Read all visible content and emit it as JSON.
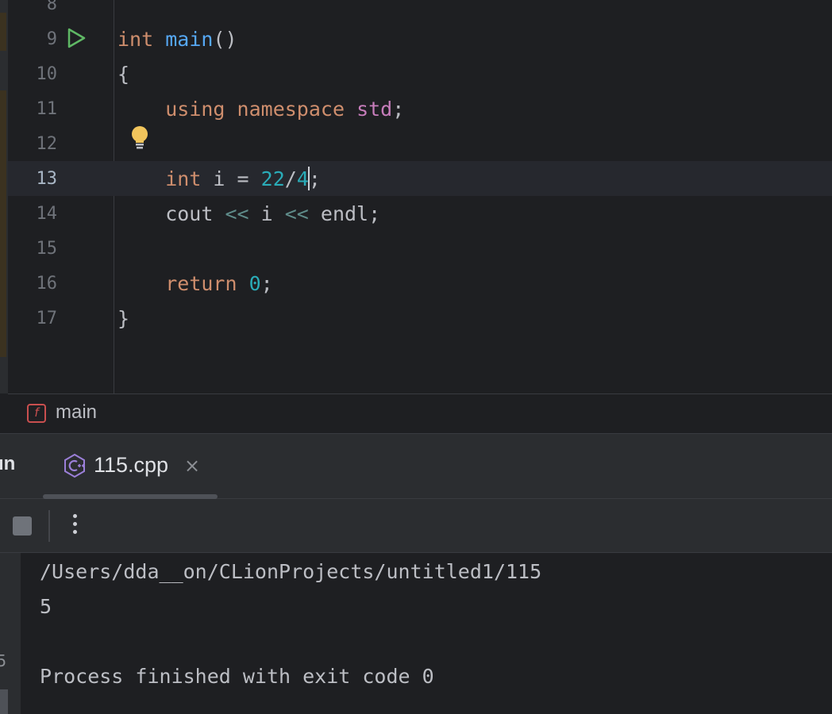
{
  "editor": {
    "lines": [
      {
        "number": "8",
        "tokens": []
      },
      {
        "number": "9",
        "tokens": [
          {
            "t": "int",
            "c": "kw"
          },
          {
            "t": " ",
            "c": "plain"
          },
          {
            "t": "main",
            "c": "fn"
          },
          {
            "t": "()",
            "c": "plain"
          }
        ]
      },
      {
        "number": "10",
        "tokens": [
          {
            "t": "{",
            "c": "plain"
          }
        ]
      },
      {
        "number": "11",
        "tokens": [
          {
            "t": "    ",
            "c": "plain"
          },
          {
            "t": "using",
            "c": "kw"
          },
          {
            "t": " ",
            "c": "plain"
          },
          {
            "t": "namespace",
            "c": "kw"
          },
          {
            "t": " ",
            "c": "plain"
          },
          {
            "t": "std",
            "c": "std"
          },
          {
            "t": ";",
            "c": "plain"
          }
        ]
      },
      {
        "number": "12",
        "tokens": []
      },
      {
        "number": "13",
        "active": true,
        "tokens": [
          {
            "t": "    ",
            "c": "plain"
          },
          {
            "t": "int",
            "c": "kw"
          },
          {
            "t": " i = ",
            "c": "plain"
          },
          {
            "t": "22",
            "c": "num"
          },
          {
            "t": "/",
            "c": "plain"
          },
          {
            "t": "4",
            "c": "num"
          },
          {
            "t": "|",
            "c": "caret"
          },
          {
            "t": ";",
            "c": "plain"
          }
        ]
      },
      {
        "number": "14",
        "tokens": [
          {
            "t": "    cout ",
            "c": "plain"
          },
          {
            "t": "<<",
            "c": "op"
          },
          {
            "t": " i ",
            "c": "plain"
          },
          {
            "t": "<<",
            "c": "op"
          },
          {
            "t": " endl;",
            "c": "plain"
          }
        ]
      },
      {
        "number": "15",
        "tokens": []
      },
      {
        "number": "16",
        "tokens": [
          {
            "t": "    ",
            "c": "plain"
          },
          {
            "t": "return",
            "c": "kw"
          },
          {
            "t": " ",
            "c": "plain"
          },
          {
            "t": "0",
            "c": "num"
          },
          {
            "t": ";",
            "c": "plain"
          }
        ]
      },
      {
        "number": "17",
        "tokens": [
          {
            "t": "}",
            "c": "plain"
          }
        ]
      }
    ]
  },
  "breadcrumb": {
    "icon_label": "f",
    "label": "main"
  },
  "tool_window": {
    "title": "un",
    "tab": {
      "label": "115.cpp",
      "close": "×"
    },
    "console_lines": [
      "/Users/dda__on/CLionProjects/untitled1/115",
      "5",
      "",
      "Process finished with exit code 0"
    ],
    "gutter_glyph": "5"
  },
  "colors": {
    "keyword": "#cf8e6d",
    "function": "#56a8f5",
    "number": "#2aacb8",
    "namespace": "#c77dbb",
    "run_icon": "#5fb865",
    "bulb": "#f2c55c"
  }
}
